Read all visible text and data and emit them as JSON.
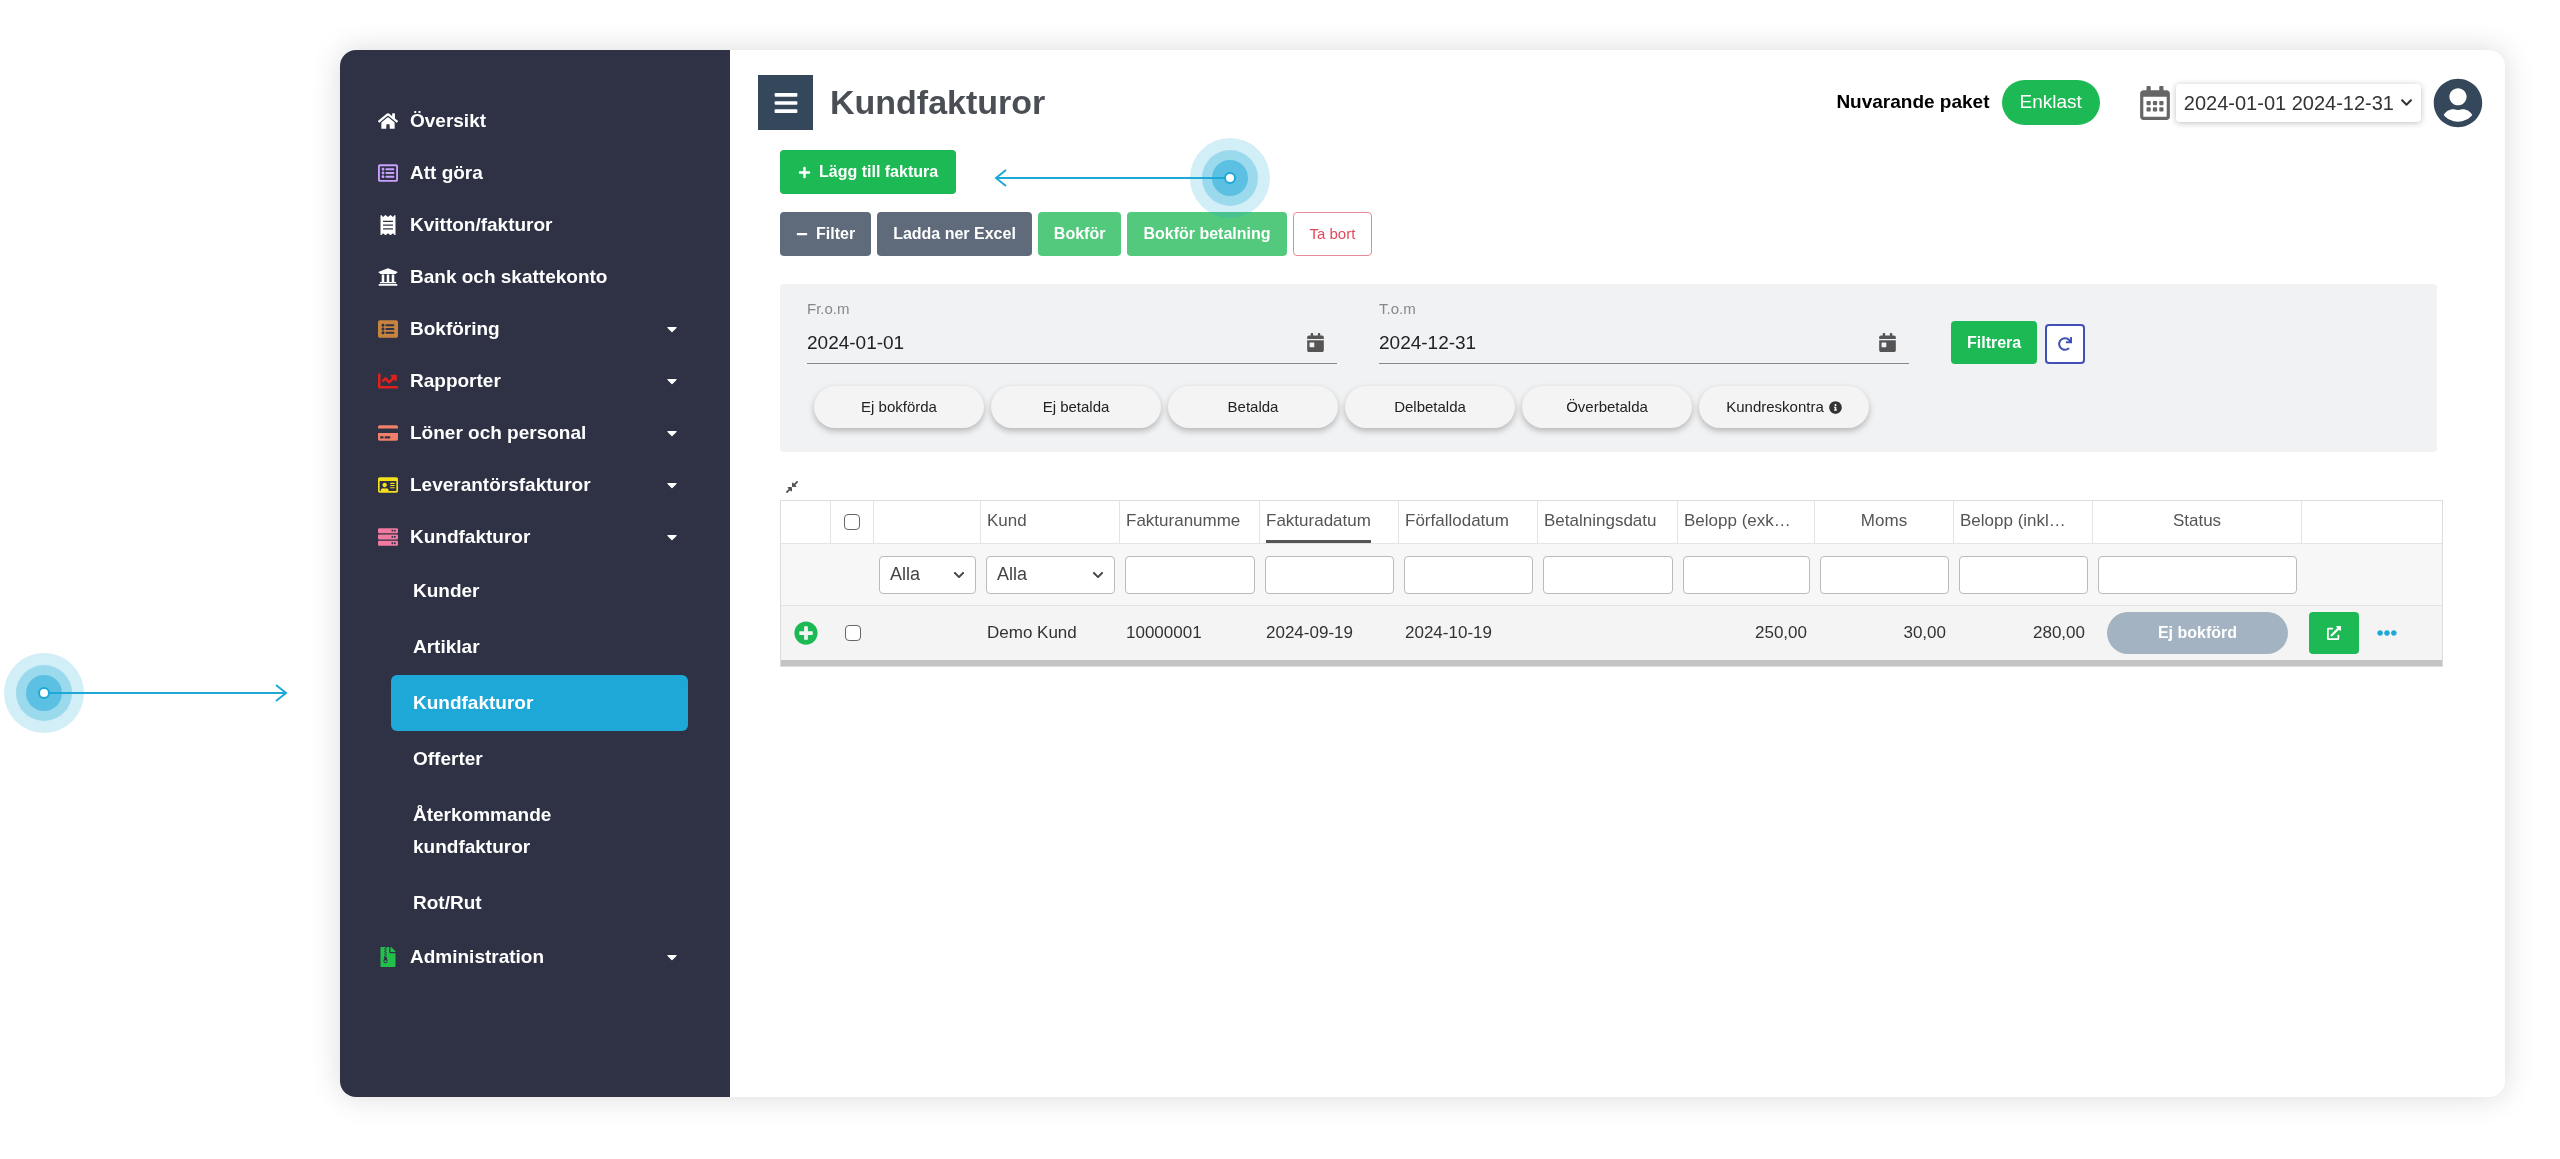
{
  "sidebar": {
    "items": [
      {
        "label": "Översikt",
        "selected": false
      },
      {
        "label": "Att göra",
        "selected": false
      },
      {
        "label": "Kvitton/fakturor",
        "selected": false
      },
      {
        "label": "Bank och skattekonto",
        "selected": false
      },
      {
        "label": "Bokföring",
        "selected": false,
        "kind": "group"
      },
      {
        "label": "Rapporter",
        "selected": false,
        "kind": "group"
      },
      {
        "label": "Löner och personal",
        "selected": false,
        "kind": "group"
      },
      {
        "label": "Leverantörsfakturor",
        "selected": false,
        "kind": "group"
      },
      {
        "label": "Kundfakturor",
        "selected": false,
        "kind": "group",
        "children": [
          {
            "label": "Kunder",
            "selected": false
          },
          {
            "label": "Artiklar",
            "selected": false
          },
          {
            "label": "Kundfakturor",
            "selected": true
          },
          {
            "label": "Offerter",
            "selected": false
          },
          {
            "label": "Återkommande kundfakturor",
            "selected": false
          },
          {
            "label": "Rot/Rut",
            "selected": false
          }
        ]
      },
      {
        "label": "Administration",
        "selected": false,
        "kind": "group"
      }
    ]
  },
  "header": {
    "title": "Kundfakturor",
    "package_label": "Nuvarande paket",
    "package": "Enklast",
    "period": "2024-01-01 2024-12-31"
  },
  "add_button": "Lägg till faktura",
  "toolbar": [
    {
      "label": "Filter",
      "kind": "filter"
    },
    {
      "label": "Ladda ner Excel",
      "kind": "dark"
    },
    {
      "label": "Bokför",
      "kind": "green"
    },
    {
      "label": "Bokför betalning",
      "kind": "green"
    },
    {
      "label": "Ta bort",
      "kind": "danger"
    }
  ],
  "filter_panel": {
    "from": {
      "label": "Fr.o.m",
      "value": "2024-01-01"
    },
    "to": {
      "label": "T.o.m",
      "value": "2024-12-31"
    },
    "apply": "Filtrera",
    "chips": [
      {
        "label": "Ej bokförda"
      },
      {
        "label": "Ej betalda"
      },
      {
        "label": "Betalda"
      },
      {
        "label": "Delbetalda"
      },
      {
        "label": "Överbetalda"
      },
      {
        "label": "Kundreskontra",
        "info": true
      }
    ]
  },
  "table": {
    "all_checked": false,
    "columns": [
      {
        "label": "Kund",
        "sorted": false
      },
      {
        "label": "Fakturanumme",
        "sorted": false
      },
      {
        "label": "Fakturadatum",
        "sorted": true
      },
      {
        "label": "Förfallodatum",
        "sorted": false
      },
      {
        "label": "Betalningsdatu",
        "sorted": false
      },
      {
        "label": "Belopp (exk…",
        "sorted": false
      },
      {
        "label": "Moms",
        "sorted": false
      },
      {
        "label": "Belopp (inkl…",
        "sorted": false
      },
      {
        "label": "Status",
        "sorted": false
      }
    ],
    "filters": [
      {
        "kind": "select",
        "value": "Alla"
      },
      {
        "kind": "select",
        "value": "Alla"
      },
      {
        "kind": "input"
      },
      {
        "kind": "input"
      },
      {
        "kind": "input"
      },
      {
        "kind": "input"
      },
      {
        "kind": "input"
      },
      {
        "kind": "input"
      },
      {
        "kind": "input"
      },
      {
        "kind": "input"
      }
    ],
    "rows": [
      {
        "checked": false,
        "customer": "Demo Kund",
        "invoice_number": "10000001",
        "invoice_date": "2024-09-19",
        "due_date": "2024-10-19",
        "amount_ex": "250,00",
        "vat": "30,00",
        "amount_incl": "280,00",
        "status": "Ej bokförd"
      }
    ]
  }
}
